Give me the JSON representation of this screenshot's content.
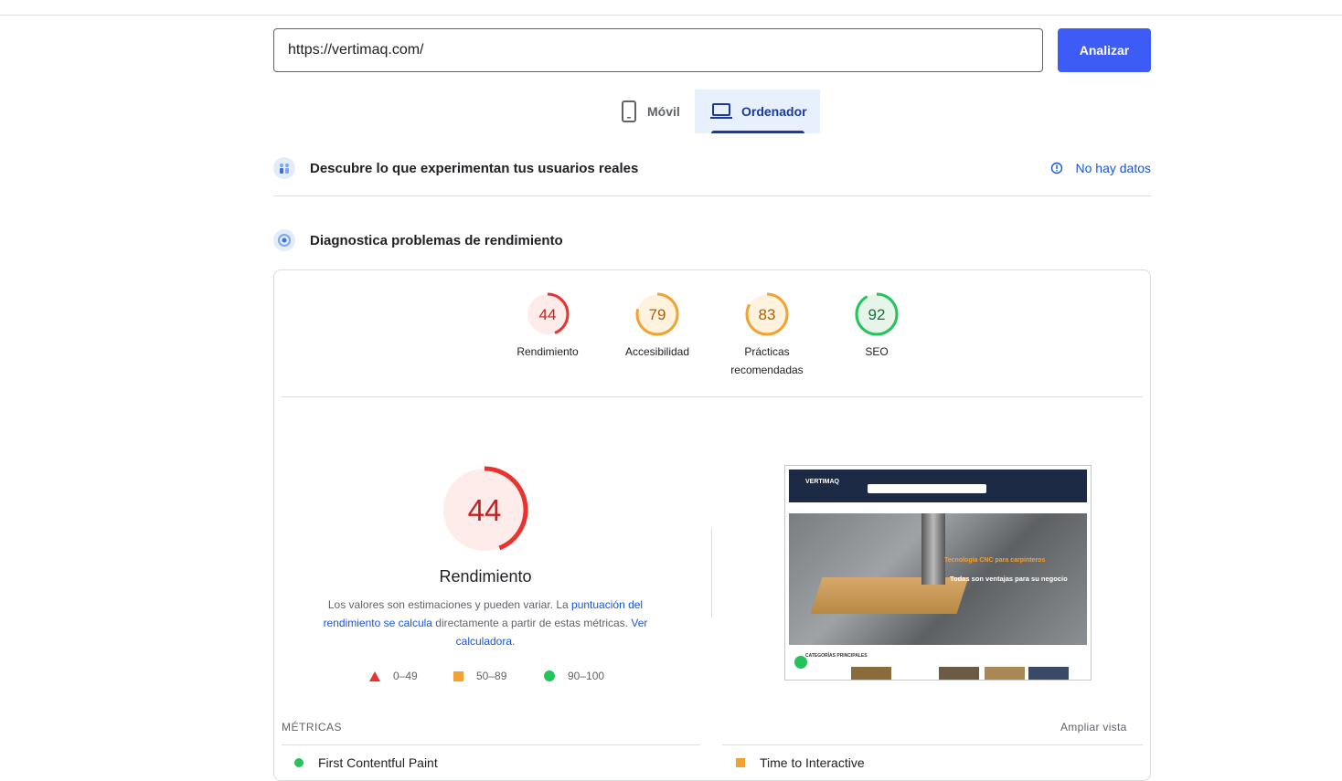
{
  "search": {
    "url": "https://vertimaq.com/",
    "button_label": "Analizar"
  },
  "tabs": [
    {
      "label": "Móvil",
      "icon": "phone-icon",
      "selected": false
    },
    {
      "label": "Ordenador",
      "icon": "laptop-icon",
      "selected": true
    }
  ],
  "field_data": {
    "title": "Descubre lo que experimentan tus usuarios reales",
    "status": "No hay datos"
  },
  "lab_data": {
    "title": "Diagnostica problemas de rendimiento"
  },
  "scores": [
    {
      "value": "44",
      "label": "Rendimiento",
      "color": "#e8332e",
      "bg": "#fdecea",
      "text_color": "#c5221f",
      "fraction": 0.44
    },
    {
      "value": "79",
      "label": "Accesibilidad",
      "color": "#f2a230",
      "bg": "#fff3e0",
      "text_color": "#b15d00",
      "fraction": 0.79
    },
    {
      "value": "83",
      "label": "Prácticas recomendadas",
      "color": "#f2a230",
      "bg": "#fff3e0",
      "text_color": "#b15d00",
      "fraction": 0.83
    },
    {
      "value": "92",
      "label": "SEO",
      "color": "#23c45a",
      "bg": "#e6f4ea",
      "text_color": "#137333",
      "fraction": 0.92
    }
  ],
  "performance": {
    "score": "44",
    "fraction": 0.44,
    "label": "Rendimiento",
    "desc_1": "Los valores son estimaciones y pueden variar. La ",
    "link_1": "puntuación del rendimiento se calcula",
    "desc_2": " directamente a partir de estas métricas. ",
    "link_2": "Ver calculadora",
    "desc_3": "."
  },
  "legend": {
    "fail": "0–49",
    "average": "50–89",
    "pass": "90–100"
  },
  "screenshot": {
    "logo": "VERTIMAQ",
    "hero_line1": "Tecnología CNC para carpinteros",
    "hero_line2": "Todas son ventajas para su negocio",
    "categories": "CATEGORÍAS PRINCIPALES"
  },
  "metrics": {
    "heading": "MÉTRICAS",
    "expand": "Ampliar vista",
    "items": [
      {
        "label": "First Contentful Paint",
        "status": "pass"
      },
      {
        "label": "Time to Interactive",
        "status": "average"
      }
    ]
  }
}
